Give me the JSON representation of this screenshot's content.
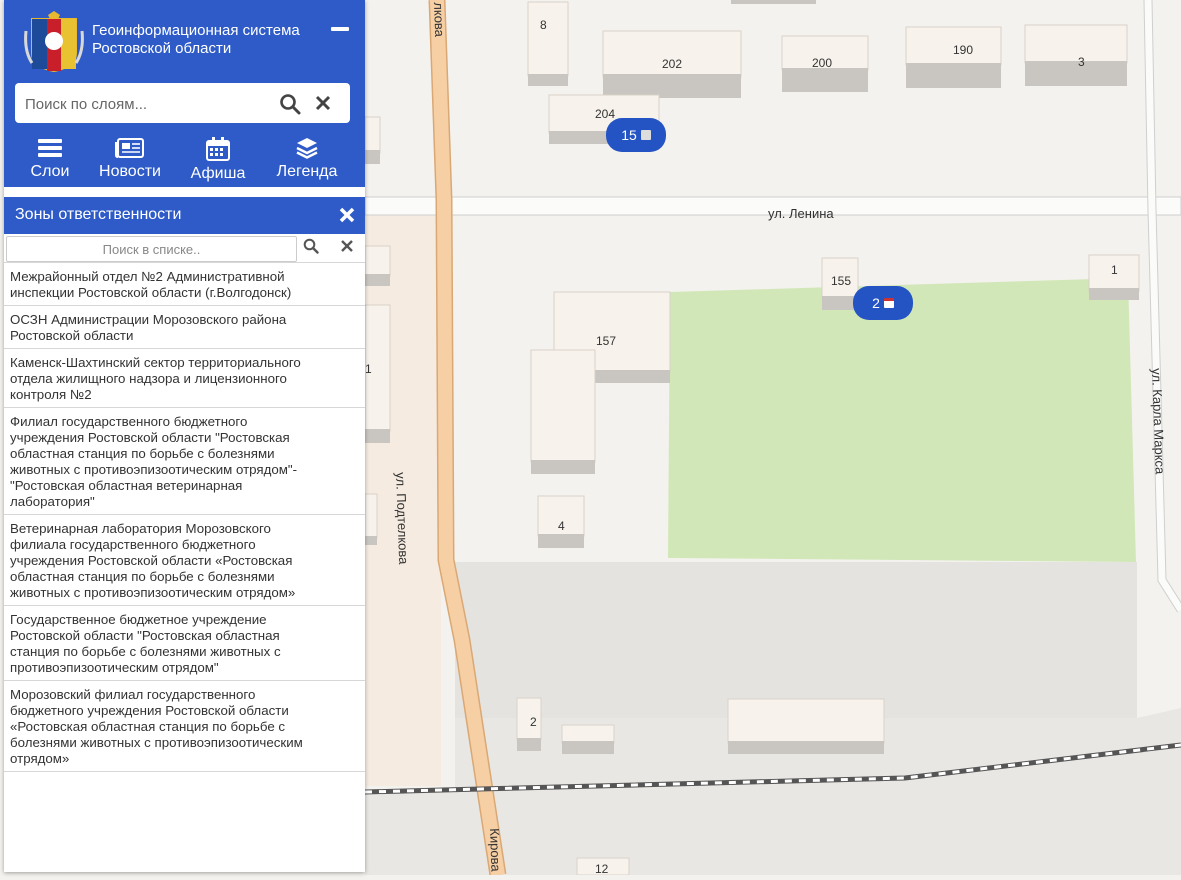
{
  "header": {
    "system_name_line1": "Геоинформационная система",
    "system_name_line2": "Ростовской области"
  },
  "search": {
    "placeholder": "Поиск по слоям..."
  },
  "nav": [
    {
      "label": "Слои",
      "icon": "menu-icon"
    },
    {
      "label": "Новости",
      "icon": "newspaper-icon"
    },
    {
      "label": "Афиша",
      "icon": "calendar-icon"
    },
    {
      "label": "Легенда",
      "icon": "layers-icon"
    }
  ],
  "zones": {
    "title": "Зоны ответственности",
    "search_placeholder": "Поиск в списке..",
    "items": [
      "Межрайонный отдел №2 Административной инспекции Ростовской области (г.Волгодонск)",
      "ОСЗН Администрации Морозовского района Ростовской области",
      "Каменск-Шахтинский сектор территориального отдела жилищного надзора и лицензионного контроля №2",
      "Филиал государственного бюджетного учреждения Ростовской области \"Ростовская областная станция по борьбе с болезнями животных с противоэпизоотическим отрядом\"- \"Ростовская областная ветеринарная лаборатория\"",
      "Ветеринарная лаборатория Морозовского филиала государственного бюджетного учреждения Ростовской области «Ростовская областная станция по борьбе с болезнями животных с противоэпизоотическим отрядом»",
      "Государственное бюджетное учреждение Ростовской области \"Ростовская областная станция по борьбе с болезнями животных с противоэпизоотическим отрядом\"",
      "Морозовский филиал государственного бюджетного учреждения Ростовской области «Ростовская областная станция по борьбе с болезнями животных с противоэпизоотическим отрядом»"
    ]
  },
  "map": {
    "streets": {
      "lenina": "ул. Ленина",
      "podtelkova": "ул. Подтелкова",
      "podtelkova_top": "лкова",
      "karla_marksa": "ул. Карла Маркса",
      "kirova": "Кирова"
    },
    "buildings": {
      "b8": "8",
      "b202": "202",
      "b200": "200",
      "b190": "190",
      "b3": "3",
      "b204": "204",
      "b155": "155",
      "b1": "1",
      "b157": "157",
      "b4": "4",
      "b2": "2",
      "b12": "12",
      "b1_left": "1"
    },
    "markers": {
      "news_count": "15",
      "events_count": "2"
    }
  },
  "colors": {
    "accent": "#2e5bc7",
    "marker": "#2454c4",
    "park": "#d1e7b8",
    "main_road": "#f5c99b"
  }
}
